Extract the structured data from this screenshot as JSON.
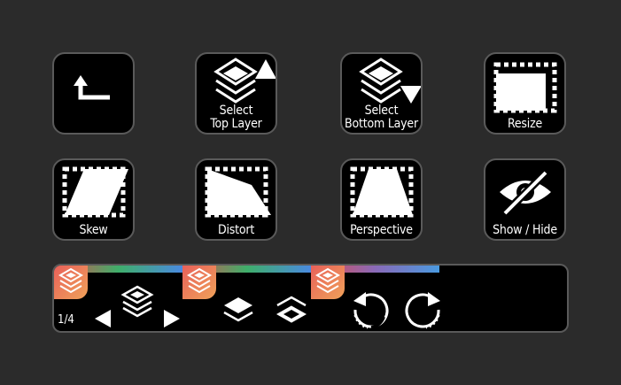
{
  "keys": {
    "back": {
      "label": "",
      "icon": "back-arrow-icon"
    },
    "select_top": {
      "label_line1": "Select",
      "label_line2": "Top Layer",
      "icon": "layers-up-icon"
    },
    "select_bottom": {
      "label_line1": "Select",
      "label_line2": "Bottom Layer",
      "icon": "layers-down-icon"
    },
    "resize": {
      "label": "Resize",
      "icon": "resize-icon"
    },
    "skew": {
      "label": "Skew",
      "icon": "skew-icon"
    },
    "distort": {
      "label": "Distort",
      "icon": "distort-icon"
    },
    "perspective": {
      "label": "Perspective",
      "icon": "perspective-icon"
    },
    "show_hide": {
      "label": "Show / Hide",
      "icon": "eye-slash-icon"
    }
  },
  "dial_strip": {
    "page": "1/4",
    "segment_colors": [
      "#e0404a",
      "#4a9ae0"
    ],
    "controls": [
      "layer-prev-icon",
      "layer-next-icon",
      "layer-above-icon",
      "layer-below-icon",
      "rotate-left-icon",
      "rotate-right-icon"
    ]
  }
}
